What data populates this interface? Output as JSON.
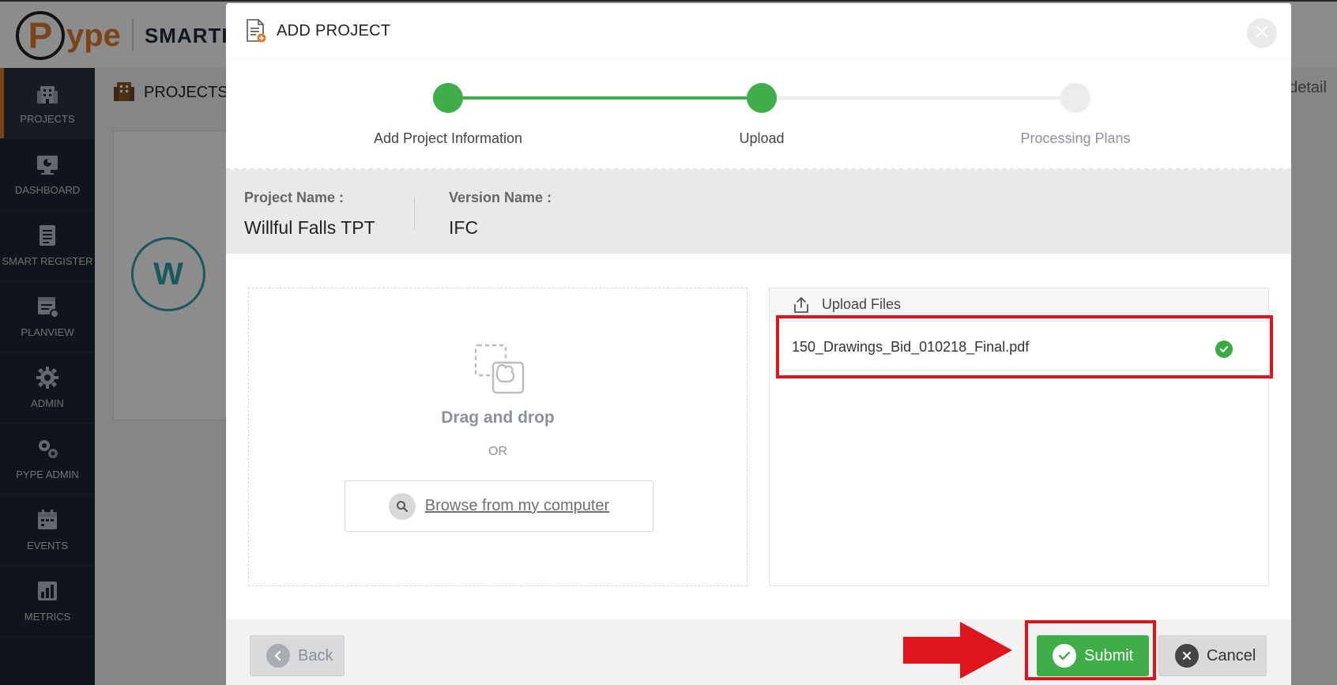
{
  "app": {
    "logo_letter": "P",
    "logo_text": "ype",
    "logo_product": "SMARTI",
    "content_title": "PROJECTS",
    "bg_avatar_letter": "W",
    "bg_right_text": "t detail"
  },
  "sidebar": {
    "items": [
      {
        "label": "PROJECTS",
        "icon": "building-icon"
      },
      {
        "label": "DASHBOARD",
        "icon": "monitor-chart-icon"
      },
      {
        "label": "SMART REGISTER",
        "icon": "list-document-icon"
      },
      {
        "label": "PLANVIEW",
        "icon": "plan-view-icon"
      },
      {
        "label": "ADMIN",
        "icon": "gear-icon"
      },
      {
        "label": "PYPE ADMIN",
        "icon": "gears-icon"
      },
      {
        "label": "EVENTS",
        "icon": "calendar-icon"
      },
      {
        "label": "METRICS",
        "icon": "bar-chart-icon"
      }
    ]
  },
  "modal": {
    "title": "ADD PROJECT",
    "steps": [
      {
        "label": "Add Project Information",
        "status": "complete"
      },
      {
        "label": "Upload",
        "status": "current"
      },
      {
        "label": "Processing Plans",
        "status": "pending"
      }
    ],
    "project": {
      "name_label": "Project Name :",
      "name_value": "Willful Falls TPT",
      "version_label": "Version Name :",
      "version_value": "IFC"
    },
    "dropzone": {
      "title": "Drag and drop",
      "or_text": "OR",
      "browse_label": "Browse from my computer"
    },
    "upload": {
      "header_label": "Upload Files",
      "files": [
        {
          "name": "150_Drawings_Bid_010218_Final.pdf",
          "status": "uploaded"
        }
      ]
    },
    "footer": {
      "back_label": "Back",
      "submit_label": "Submit",
      "cancel_label": "Cancel"
    }
  },
  "colors": {
    "accent_orange": "#e07a2c",
    "success_green": "#3fae49",
    "sidebar_bg": "#1e2732",
    "annotation_red": "#e0141e"
  }
}
